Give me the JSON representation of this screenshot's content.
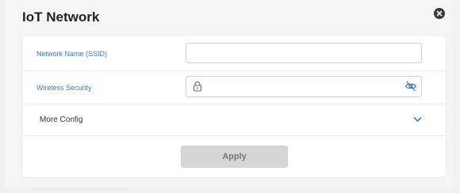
{
  "dialog": {
    "title": "IoT Network",
    "close_icon": "close-icon"
  },
  "form": {
    "ssid": {
      "label": "Network Name (SSID)",
      "value": "",
      "placeholder": ""
    },
    "security": {
      "label": "Wireless Security",
      "value": "",
      "placeholder": "",
      "lock_icon": "lock-icon",
      "visibility_icon": "eye-off-icon"
    },
    "more_config": {
      "label": "More Config",
      "expand_icon": "chevron-down-icon"
    }
  },
  "actions": {
    "apply_label": "Apply"
  },
  "colors": {
    "label_blue": "#3a78d4",
    "apply_bg": "#d6d6d6",
    "apply_text": "#777777",
    "close_bg": "#3b3b3b"
  }
}
